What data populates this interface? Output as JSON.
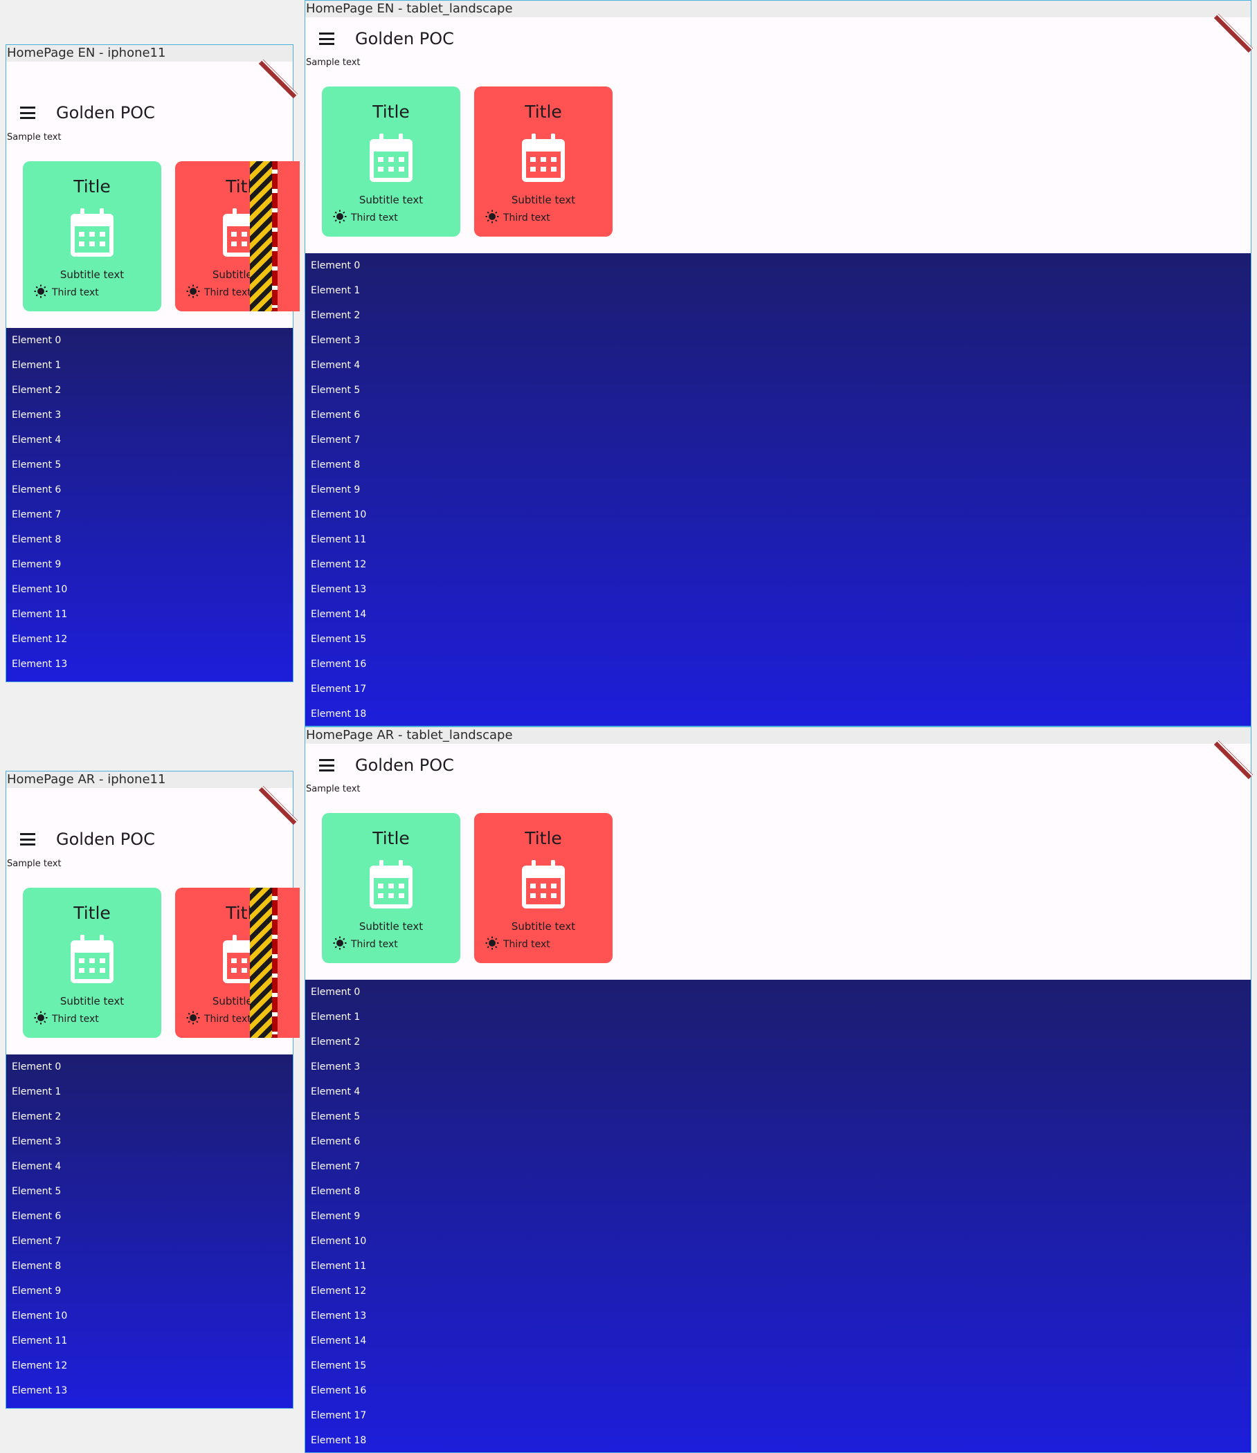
{
  "frames": [
    {
      "label": "HomePage EN - iphone11",
      "app_title": "Golden POC",
      "sample_text": "Sample text",
      "cards": [
        {
          "title": "Title",
          "subtitle": "Subtitle text",
          "third": "Third text",
          "color": "#69f0ae"
        },
        {
          "title": "Title",
          "subtitle": "Subtitle text",
          "third": "Third text",
          "color": "#ff5252"
        }
      ],
      "list_items": [
        "Element 0",
        "Element 1",
        "Element 2",
        "Element 3",
        "Element 4",
        "Element 5",
        "Element 6",
        "Element 7",
        "Element 8",
        "Element 9",
        "Element 10",
        "Element 11",
        "Element 12",
        "Element 13"
      ],
      "overflow_warning": true
    },
    {
      "label": "HomePage EN - tablet_landscape",
      "app_title": "Golden POC",
      "sample_text": "Sample text",
      "cards": [
        {
          "title": "Title",
          "subtitle": "Subtitle text",
          "third": "Third text",
          "color": "#69f0ae"
        },
        {
          "title": "Title",
          "subtitle": "Subtitle text",
          "third": "Third text",
          "color": "#ff5252"
        }
      ],
      "list_items": [
        "Element 0",
        "Element 1",
        "Element 2",
        "Element 3",
        "Element 4",
        "Element 5",
        "Element 6",
        "Element 7",
        "Element 8",
        "Element 9",
        "Element 10",
        "Element 11",
        "Element 12",
        "Element 13",
        "Element 14",
        "Element 15",
        "Element 16",
        "Element 17",
        "Element 18"
      ],
      "overflow_warning": false
    },
    {
      "label": "HomePage AR - iphone11",
      "app_title": "Golden POC",
      "sample_text": "Sample text",
      "cards": [
        {
          "title": "Title",
          "subtitle": "Subtitle text",
          "third": "Third text",
          "color": "#69f0ae"
        },
        {
          "title": "Title",
          "subtitle": "Subtitle text",
          "third": "Third text",
          "color": "#ff5252"
        }
      ],
      "list_items": [
        "Element 0",
        "Element 1",
        "Element 2",
        "Element 3",
        "Element 4",
        "Element 5",
        "Element 6",
        "Element 7",
        "Element 8",
        "Element 9",
        "Element 10",
        "Element 11",
        "Element 12",
        "Element 13"
      ],
      "overflow_warning": true
    },
    {
      "label": "HomePage AR - tablet_landscape",
      "app_title": "Golden POC",
      "sample_text": "Sample text",
      "cards": [
        {
          "title": "Title",
          "subtitle": "Subtitle text",
          "third": "Third text",
          "color": "#69f0ae"
        },
        {
          "title": "Title",
          "subtitle": "Subtitle text",
          "third": "Third text",
          "color": "#ff5252"
        }
      ],
      "list_items": [
        "Element 0",
        "Element 1",
        "Element 2",
        "Element 3",
        "Element 4",
        "Element 5",
        "Element 6",
        "Element 7",
        "Element 8",
        "Element 9",
        "Element 10",
        "Element 11",
        "Element 12",
        "Element 13",
        "Element 14",
        "Element 15",
        "Element 16",
        "Element 17",
        "Element 18"
      ],
      "overflow_warning": false
    }
  ],
  "colors": {
    "frame_border": "#4ab0dd",
    "list_gradient_top": "#1c1d70",
    "list_gradient_bottom": "#1d1eda",
    "debug_banner": "#a03030"
  },
  "icons": {
    "menu": "hamburger-menu-icon",
    "calendar": "calendar-icon",
    "third": "sun-icon",
    "banner": "debug-banner-icon"
  }
}
